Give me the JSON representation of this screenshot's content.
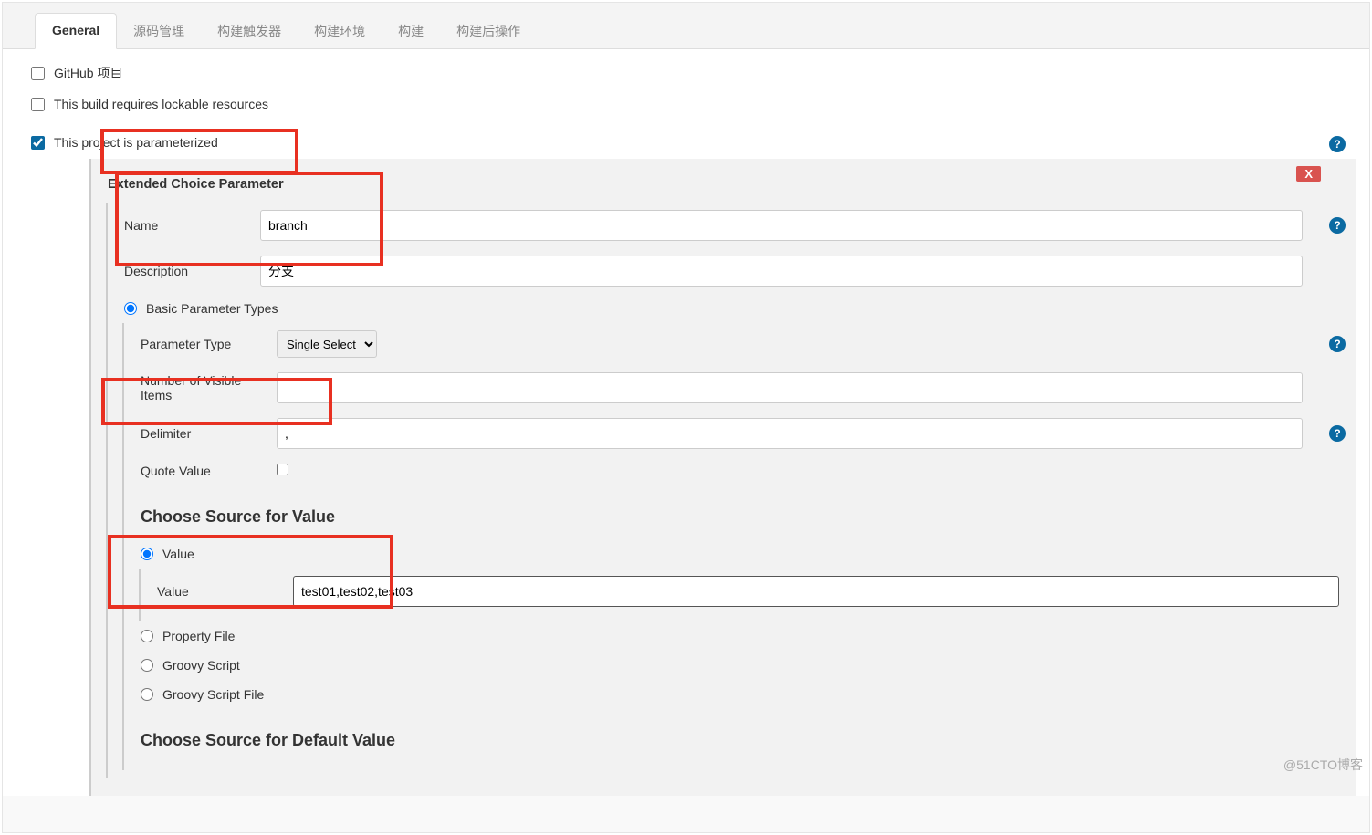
{
  "tabs": [
    {
      "label": "General",
      "active": true
    },
    {
      "label": "源码管理",
      "active": false
    },
    {
      "label": "构建触发器",
      "active": false
    },
    {
      "label": "构建环境",
      "active": false
    },
    {
      "label": "构建",
      "active": false
    },
    {
      "label": "构建后操作",
      "active": false
    }
  ],
  "checks": {
    "github_project": {
      "label": "GitHub 项目",
      "checked": false
    },
    "lockable": {
      "label": "This build requires lockable resources",
      "checked": false
    },
    "parameterized": {
      "label": "This project is parameterized",
      "checked": true
    }
  },
  "param": {
    "section_title": "Extended Choice Parameter",
    "delete_label": "X",
    "name": {
      "label": "Name",
      "value": "branch"
    },
    "description": {
      "label": "Description",
      "value": "分支"
    },
    "basic_types": {
      "radio_label": "Basic Parameter Types",
      "parameter_type": {
        "label": "Parameter Type",
        "selected": "Single Select"
      },
      "visible_items": {
        "label": "Number of Visible Items",
        "value": ""
      },
      "delimiter": {
        "label": "Delimiter",
        "value": ","
      },
      "quote_value": {
        "label": "Quote Value",
        "checked": false
      }
    },
    "source_value": {
      "heading": "Choose Source for Value",
      "options": {
        "value": {
          "label": "Value",
          "field_label": "Value",
          "field_value": "test01,test02,test03"
        },
        "property_file": {
          "label": "Property File"
        },
        "groovy_script": {
          "label": "Groovy Script"
        },
        "groovy_script_file": {
          "label": "Groovy Script File"
        }
      }
    },
    "source_default": {
      "heading": "Choose Source for Default Value"
    }
  },
  "watermark": "@51CTO博客"
}
